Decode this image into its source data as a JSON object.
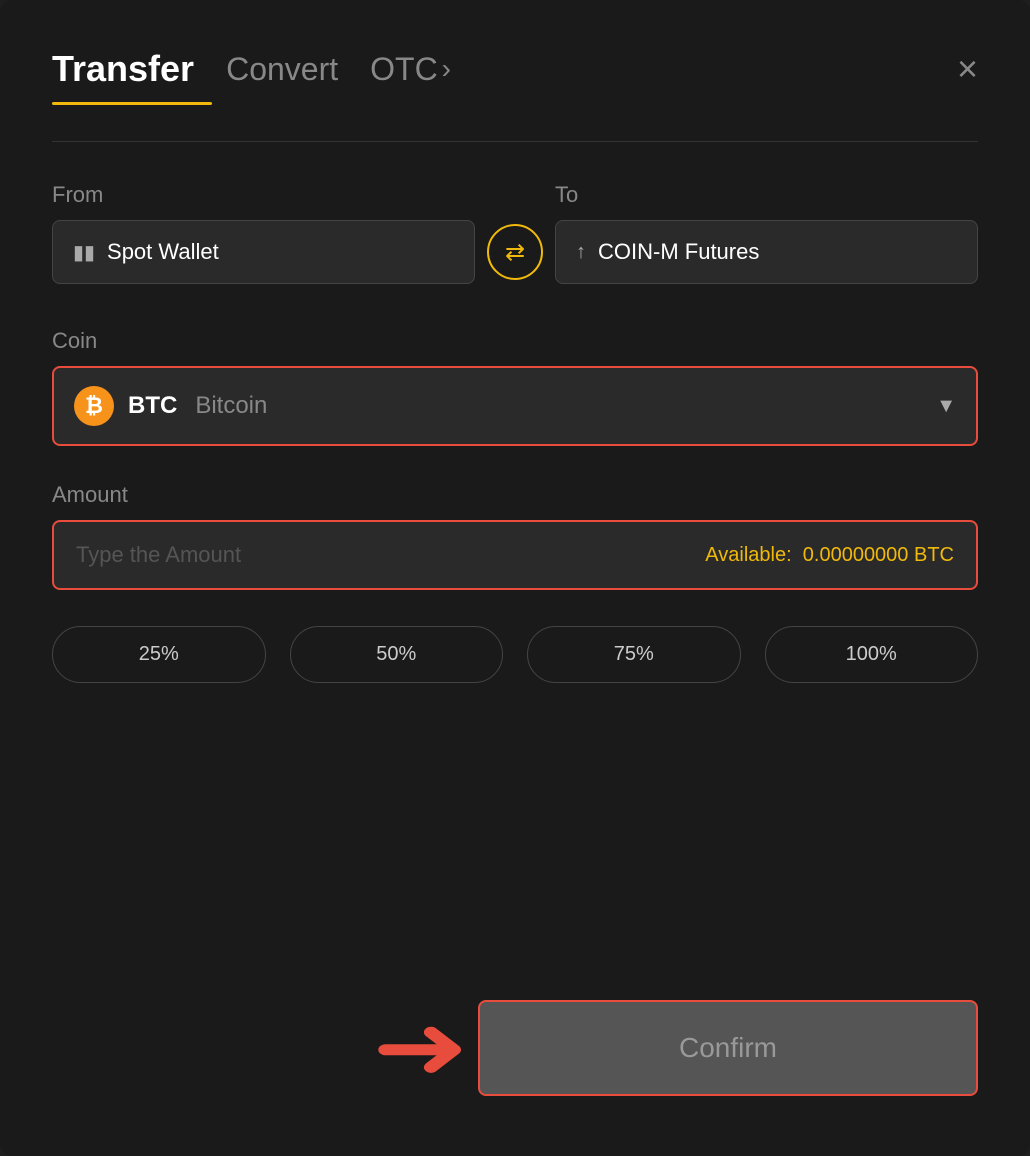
{
  "header": {
    "tab_transfer": "Transfer",
    "tab_convert": "Convert",
    "tab_otc": "OTC",
    "tab_otc_chevron": "›",
    "close_label": "×"
  },
  "from_section": {
    "label": "From",
    "wallet_name": "Spot Wallet"
  },
  "to_section": {
    "label": "To",
    "wallet_name": "COIN-M Futures"
  },
  "swap": {
    "icon": "⇄"
  },
  "coin_section": {
    "label": "Coin",
    "coin_symbol": "BTC",
    "coin_full_name": "Bitcoin",
    "btc_icon_text": "₿"
  },
  "amount_section": {
    "label": "Amount",
    "placeholder": "Type the Amount",
    "available_label": "Available:",
    "available_value": "0.00000000 BTC"
  },
  "percent_buttons": [
    {
      "label": "25%"
    },
    {
      "label": "50%"
    },
    {
      "label": "75%"
    },
    {
      "label": "100%"
    }
  ],
  "confirm_button": {
    "label": "Confirm"
  }
}
